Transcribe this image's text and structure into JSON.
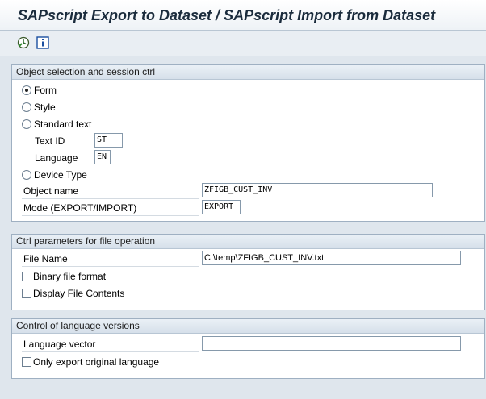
{
  "window": {
    "title": "SAPscript Export to Dataset / SAPscript Import from Dataset"
  },
  "toolbar": {
    "execute_icon": "execute-clock-icon",
    "info_icon": "information-icon"
  },
  "group_object": {
    "header": "Object selection and session ctrl",
    "radio_form": "Form",
    "radio_style": "Style",
    "radio_standard_text": "Standard text",
    "text_id_label": "Text ID",
    "text_id_value": "ST",
    "language_label": "Language",
    "language_value": "EN",
    "radio_device_type": "Device Type",
    "object_name_label": "Object name",
    "object_name_value": "ZFIGB_CUST_INV",
    "mode_label": "Mode (EXPORT/IMPORT)",
    "mode_value": "EXPORT",
    "selected": "Form"
  },
  "group_file": {
    "header": "Ctrl parameters for file operation",
    "file_name_label": "File Name",
    "file_name_value": "C:\\temp\\ZFIGB_CUST_INV.txt",
    "binary_label": "Binary file format",
    "display_label": "Display File Contents"
  },
  "group_lang": {
    "header": "Control of language versions",
    "lang_vector_label": "Language vector",
    "lang_vector_value": "",
    "only_original_label": "Only export original language"
  }
}
